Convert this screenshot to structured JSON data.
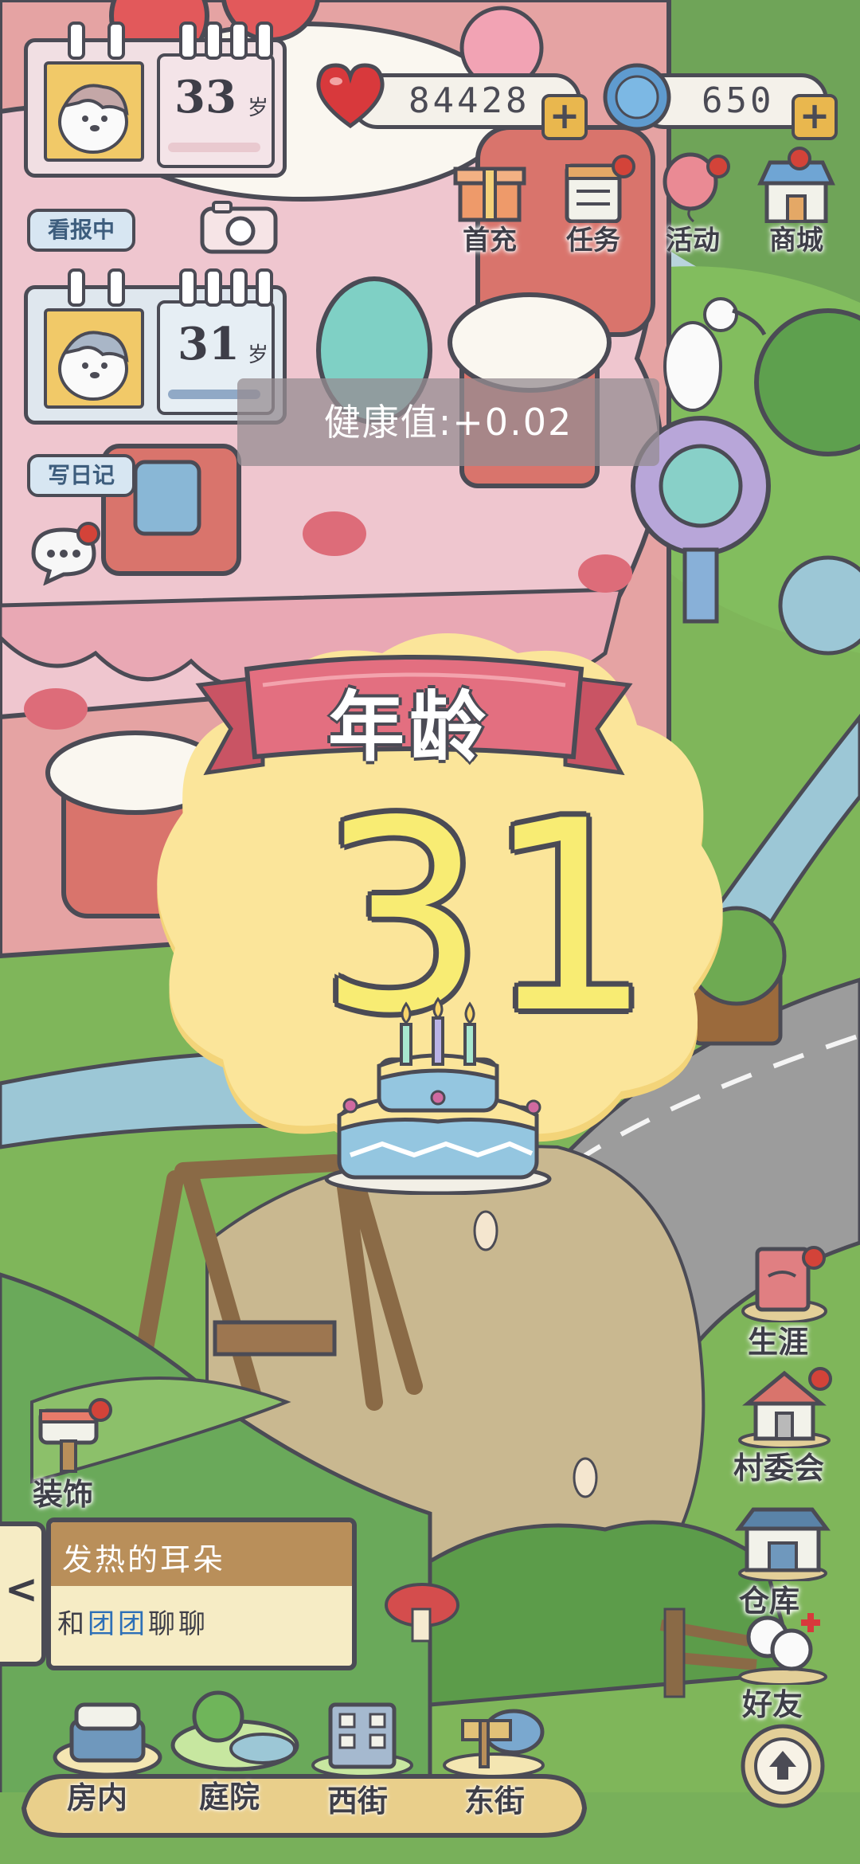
{
  "player1": {
    "age": "33",
    "age_unit": "岁"
  },
  "player2": {
    "age": "31",
    "age_unit": "岁"
  },
  "buttons": {
    "news": "看报中",
    "diary": "写日记"
  },
  "currency": {
    "hearts": "84428",
    "gems": "650",
    "plus": "+"
  },
  "top_menu": [
    {
      "label": "首充",
      "icon": "gift-icon"
    },
    {
      "label": "任务",
      "icon": "task-board-icon"
    },
    {
      "label": "活动",
      "icon": "balloon-icon"
    },
    {
      "label": "商城",
      "icon": "shop-icon"
    }
  ],
  "toast": {
    "text": "健康值:+0.02"
  },
  "popup": {
    "title": "年龄",
    "age": "31",
    "icon": "birthday-cake-icon"
  },
  "side_menu": {
    "career": "生涯",
    "village": "村委会",
    "decor": "装饰",
    "warehouse": "仓库",
    "friends": "好友"
  },
  "chat": {
    "title": "发热的耳朵",
    "prefix": "和",
    "name": "团团",
    "suffix": "聊聊",
    "arrow": "<"
  },
  "bottom_nav": [
    {
      "label": "房内",
      "icon": "bed-icon"
    },
    {
      "label": "庭院",
      "icon": "garden-icon"
    },
    {
      "label": "西街",
      "icon": "building-icon"
    },
    {
      "label": "东街",
      "icon": "street-sign-icon"
    }
  ],
  "colors": {
    "accent_pink": "#e36f80",
    "popup_yellow": "#fbe59a",
    "outline": "#4b4b55",
    "link_blue": "#2d6fb7"
  }
}
